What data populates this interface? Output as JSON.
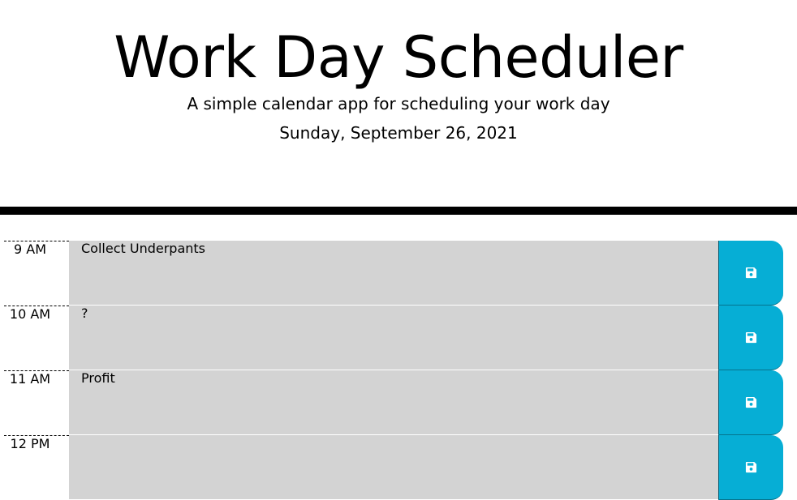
{
  "header": {
    "title": "Work Day Scheduler",
    "lead": "A simple calendar app for scheduling your work day",
    "current_day": "Sunday, September 26, 2021"
  },
  "colors": {
    "past": "#d3d3d3",
    "save_button": "#06aed5",
    "divider": "#000000"
  },
  "timeblocks": [
    {
      "hour": "9 AM",
      "text": "Collect Underpants",
      "save_icon": "floppy-disk-icon"
    },
    {
      "hour": "10 AM",
      "text": "?",
      "save_icon": "floppy-disk-icon"
    },
    {
      "hour": "11 AM",
      "text": "Profit",
      "save_icon": "floppy-disk-icon"
    },
    {
      "hour": "12 PM",
      "text": "",
      "save_icon": "floppy-disk-icon"
    }
  ]
}
